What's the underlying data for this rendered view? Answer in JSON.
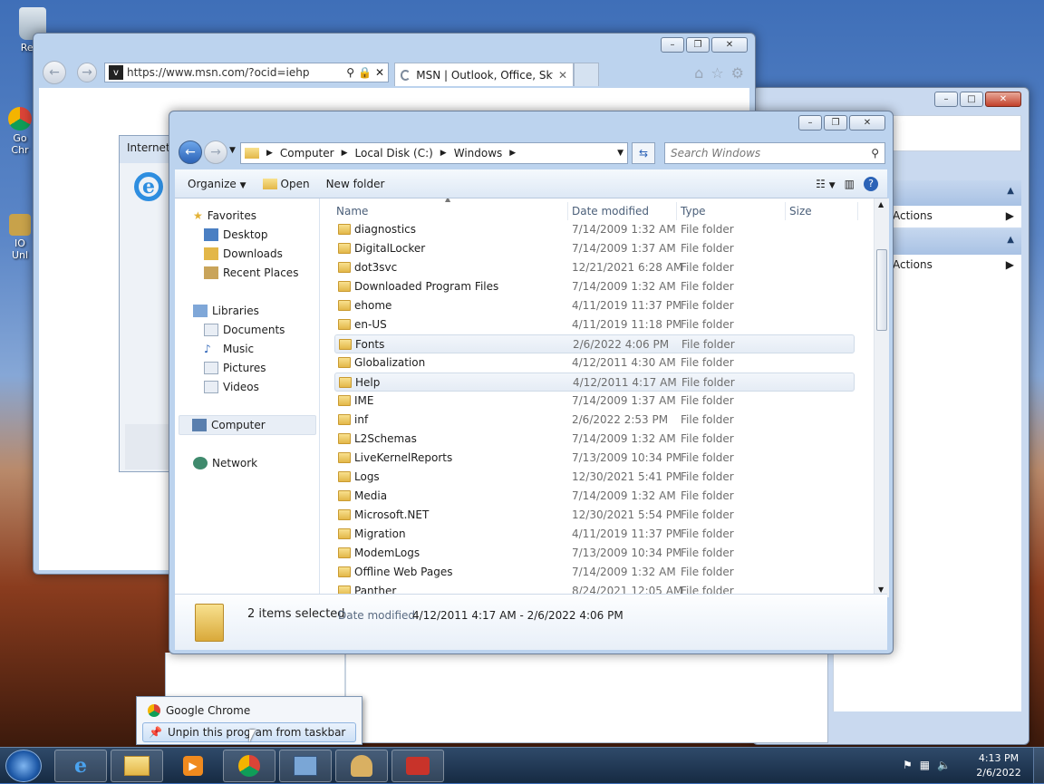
{
  "desktop": {
    "icons": [
      {
        "label": "Recy"
      },
      {
        "label": "Go\nChr"
      },
      {
        "label": "IO\nUnl"
      }
    ]
  },
  "ie": {
    "url": "https://www.msn.com/?ocid=iehp",
    "tab_title": "MSN | Outlook, Office, Sky...",
    "inner_window_title": "Internet"
  },
  "backwin": {
    "items": [
      {
        "label": "Actions"
      },
      {
        "label": "Actions"
      }
    ]
  },
  "explorer": {
    "breadcrumb": [
      "Computer",
      "Local Disk (C:)",
      "Windows"
    ],
    "search_placeholder": "Search Windows",
    "toolbar": {
      "organize": "Organize",
      "open": "Open",
      "new_folder": "New folder"
    },
    "nav": {
      "favorites": "Favorites",
      "desktop": "Desktop",
      "downloads": "Downloads",
      "recent": "Recent Places",
      "libraries": "Libraries",
      "documents": "Documents",
      "music": "Music",
      "pictures": "Pictures",
      "videos": "Videos",
      "computer": "Computer",
      "network": "Network"
    },
    "columns": {
      "name": "Name",
      "date": "Date modified",
      "type": "Type",
      "size": "Size"
    },
    "rows": [
      {
        "name": "diagnostics",
        "date": "7/14/2009 1:32 AM",
        "type": "File folder"
      },
      {
        "name": "DigitalLocker",
        "date": "7/14/2009 1:37 AM",
        "type": "File folder"
      },
      {
        "name": "dot3svc",
        "date": "12/21/2021 6:28 AM",
        "type": "File folder"
      },
      {
        "name": "Downloaded Program Files",
        "date": "7/14/2009 1:32 AM",
        "type": "File folder"
      },
      {
        "name": "ehome",
        "date": "4/11/2019 11:37 PM",
        "type": "File folder"
      },
      {
        "name": "en-US",
        "date": "4/11/2019 11:18 PM",
        "type": "File folder"
      },
      {
        "name": "Fonts",
        "date": "2/6/2022 4:06 PM",
        "type": "File folder",
        "selected": true
      },
      {
        "name": "Globalization",
        "date": "4/12/2011 4:30 AM",
        "type": "File folder"
      },
      {
        "name": "Help",
        "date": "4/12/2011 4:17 AM",
        "type": "File folder",
        "selected": true
      },
      {
        "name": "IME",
        "date": "7/14/2009 1:37 AM",
        "type": "File folder"
      },
      {
        "name": "inf",
        "date": "2/6/2022 2:53 PM",
        "type": "File folder"
      },
      {
        "name": "L2Schemas",
        "date": "7/14/2009 1:32 AM",
        "type": "File folder"
      },
      {
        "name": "LiveKernelReports",
        "date": "7/13/2009 10:34 PM",
        "type": "File folder"
      },
      {
        "name": "Logs",
        "date": "12/30/2021 5:41 PM",
        "type": "File folder"
      },
      {
        "name": "Media",
        "date": "7/14/2009 1:32 AM",
        "type": "File folder"
      },
      {
        "name": "Microsoft.NET",
        "date": "12/30/2021 5:54 PM",
        "type": "File folder"
      },
      {
        "name": "Migration",
        "date": "4/11/2019 11:37 PM",
        "type": "File folder"
      },
      {
        "name": "ModemLogs",
        "date": "7/13/2009 10:34 PM",
        "type": "File folder"
      },
      {
        "name": "Offline Web Pages",
        "date": "7/14/2009 1:32 AM",
        "type": "File folder"
      },
      {
        "name": "Panther",
        "date": "8/24/2021 12:05 AM",
        "type": "File folder"
      }
    ],
    "details": {
      "count": "2 items selected",
      "date_label": "Date modified:",
      "date_range": "4/12/2011 4:17 AM - 2/6/2022 4:06 PM"
    }
  },
  "jumplist": {
    "app": "Google Chrome",
    "unpin": "Unpin this program from taskbar"
  },
  "taskbar": {
    "time": "4:13 PM",
    "date": "2/6/2022"
  },
  "colors": {
    "accent": "#3d7ad6",
    "selection": "#e5ecf5"
  }
}
